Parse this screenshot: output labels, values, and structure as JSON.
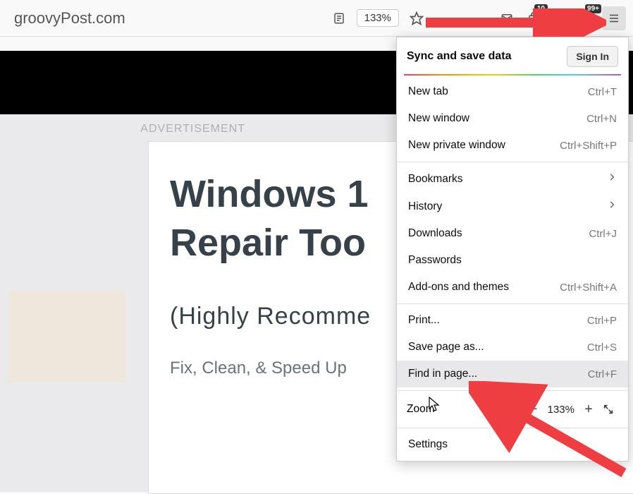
{
  "toolbar": {
    "url": "groovyPost.com",
    "zoom": "133%",
    "badge_count": "10",
    "badge_plus": "99+"
  },
  "page": {
    "ad_label": "ADVERTISEMENT",
    "headline_line1": "Windows 1",
    "headline_line2": "Repair Too",
    "subhead": "(Highly Recomme",
    "body": "Fix, Clean, & Speed Up"
  },
  "menu": {
    "sync_label": "Sync and save data",
    "signin": "Sign In",
    "new_tab": {
      "label": "New tab",
      "key": "Ctrl+T"
    },
    "new_window": {
      "label": "New window",
      "key": "Ctrl+N"
    },
    "new_private": {
      "label": "New private window",
      "key": "Ctrl+Shift+P"
    },
    "bookmarks": {
      "label": "Bookmarks"
    },
    "history": {
      "label": "History"
    },
    "downloads": {
      "label": "Downloads",
      "key": "Ctrl+J"
    },
    "passwords": {
      "label": "Passwords"
    },
    "addons": {
      "label": "Add-ons and themes",
      "key": "Ctrl+Shift+A"
    },
    "print": {
      "label": "Print...",
      "key": "Ctrl+P"
    },
    "save_as": {
      "label": "Save page as...",
      "key": "Ctrl+S"
    },
    "find": {
      "label": "Find in page...",
      "key": "Ctrl+F"
    },
    "zoom": {
      "label": "Zoom",
      "value": "133%"
    },
    "settings": {
      "label": "Settings"
    }
  }
}
